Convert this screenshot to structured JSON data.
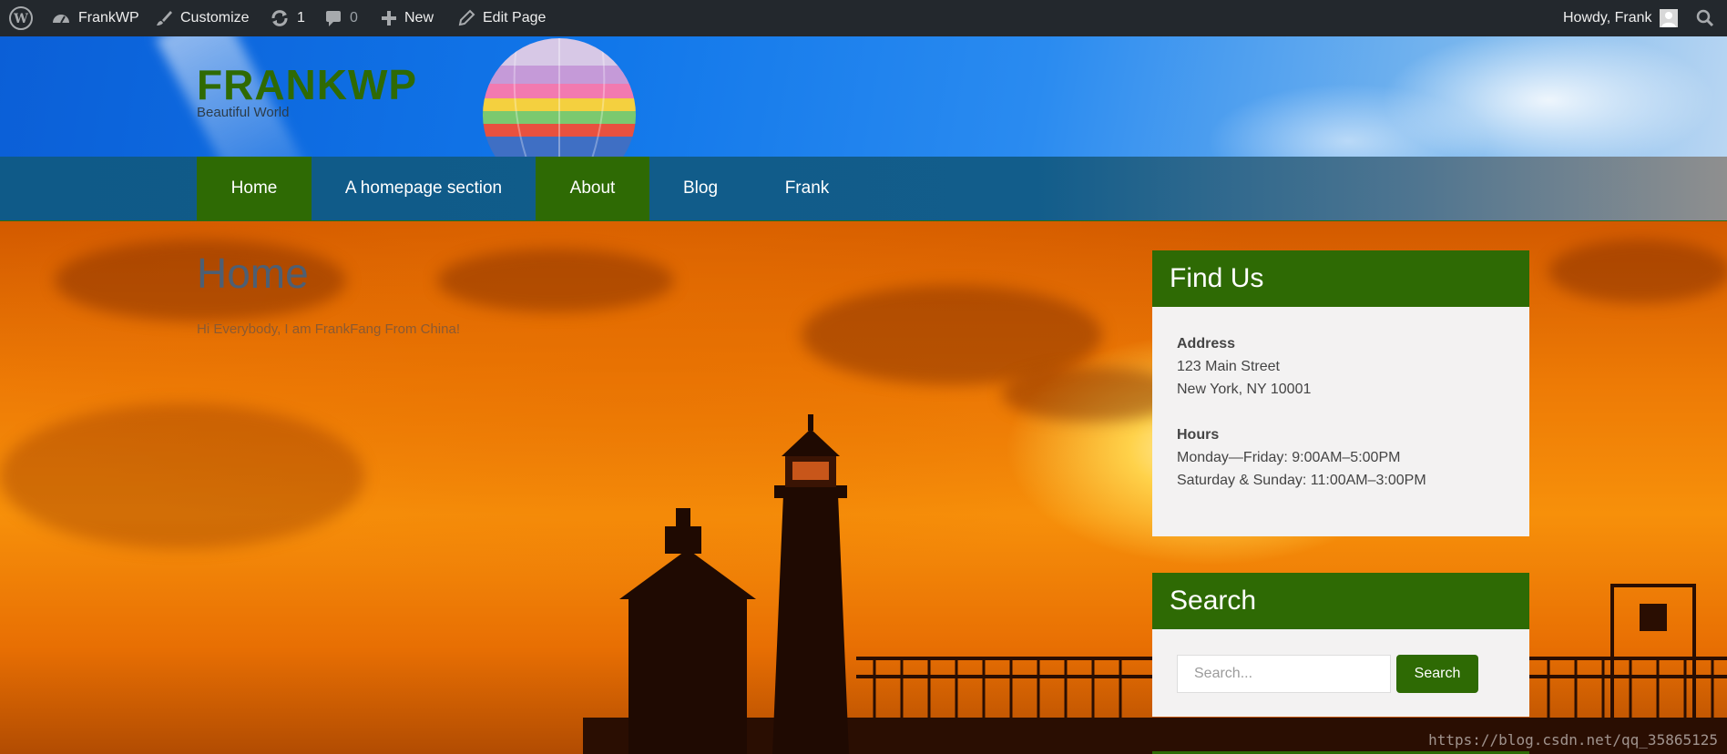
{
  "admin_bar": {
    "site_name": "FrankWP",
    "customize": "Customize",
    "updates_count": "1",
    "comments_count": "0",
    "new_label": "New",
    "edit_page": "Edit Page",
    "howdy": "Howdy, Frank"
  },
  "header": {
    "site_title": "FRANKWP",
    "tagline": "Beautiful World"
  },
  "nav": {
    "items": [
      {
        "label": "Home",
        "active": true
      },
      {
        "label": "A homepage section",
        "active": false
      },
      {
        "label": "About",
        "active": true
      },
      {
        "label": "Blog",
        "active": false
      },
      {
        "label": "Frank",
        "active": false
      }
    ]
  },
  "main": {
    "page_title": "Home",
    "intro": "Hi Everybody, I am FrankFang From China!"
  },
  "sidebar": {
    "find_us": {
      "title": "Find Us",
      "address_label": "Address",
      "address_line1": "123 Main Street",
      "address_line2": "New York, NY 10001",
      "hours_label": "Hours",
      "hours_line1": "Monday—Friday: 9:00AM–5:00PM",
      "hours_line2": "Saturday & Sunday: 11:00AM–3:00PM"
    },
    "search": {
      "title": "Search",
      "placeholder": "Search...",
      "button_label": "Search"
    }
  },
  "watermark": "https://blog.csdn.net/qq_35865125",
  "colors": {
    "admin_bar": "#23282d",
    "accent_green": "#2e6a04",
    "nav_blue": "#125d8b",
    "widget_bg": "#f3f2f2"
  }
}
